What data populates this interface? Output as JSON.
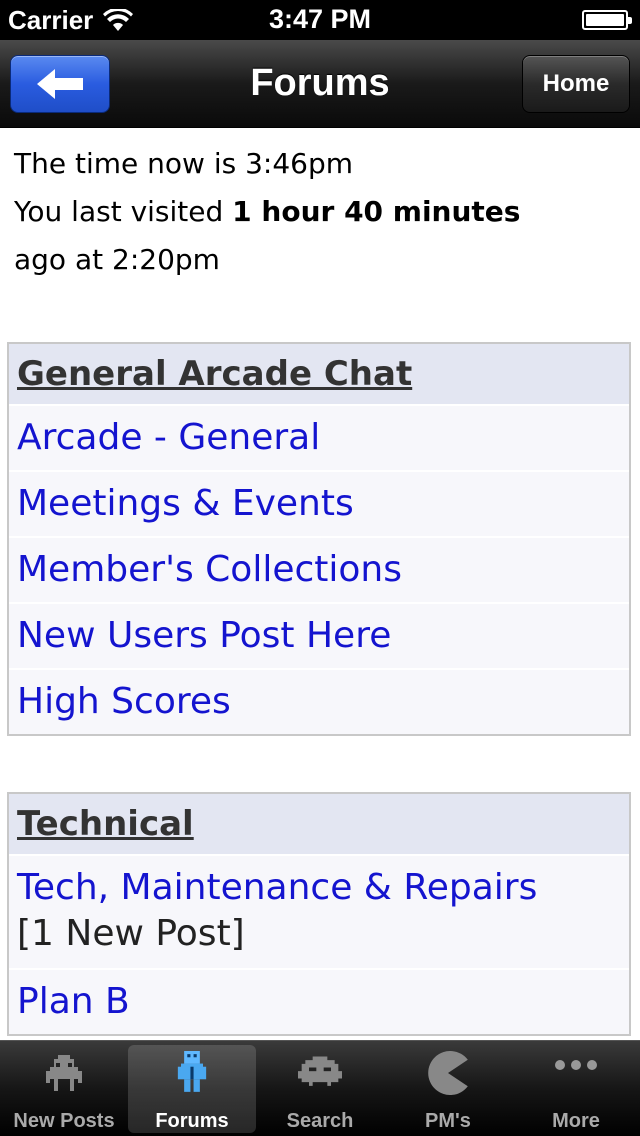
{
  "status_bar": {
    "carrier": "Carrier",
    "time": "3:47 PM"
  },
  "nav": {
    "title": "Forums",
    "back_icon": "left-arrow",
    "home_label": "Home"
  },
  "visit_info": {
    "time_now": "The time now is 3:46pm",
    "last_visited_prefix": "You last visited ",
    "last_visited_duration": "1 hour 40 minutes",
    "last_visited_suffix": "ago at 2:20pm"
  },
  "sections": [
    {
      "title": "General Arcade Chat",
      "forums": [
        {
          "name": "Arcade - General"
        },
        {
          "name": "Meetings & Events"
        },
        {
          "name": "Member's Collections"
        },
        {
          "name": "New Users Post Here"
        },
        {
          "name": "High Scores"
        }
      ]
    },
    {
      "title": "Technical",
      "forums": [
        {
          "name": "Tech, Maintenance & Repairs",
          "new_posts": "[1 New Post]"
        },
        {
          "name": "Plan B"
        }
      ]
    }
  ],
  "tabs": [
    {
      "label": "New Posts",
      "icon": "space-invader-icon"
    },
    {
      "label": "Forums",
      "icon": "robot-icon",
      "active": true
    },
    {
      "label": "Search",
      "icon": "space-invader-icon"
    },
    {
      "label": "PM's",
      "icon": "pacman-icon"
    },
    {
      "label": "More",
      "icon": "more-icon"
    }
  ],
  "colors": {
    "link": "#1414cf",
    "back_button": "#2a5ce0",
    "section_header": "#e3e6f2"
  }
}
